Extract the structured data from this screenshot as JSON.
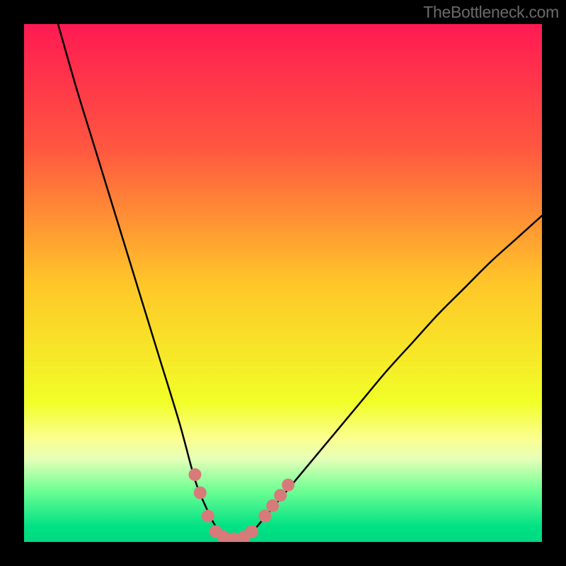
{
  "watermark": "TheBottleneck.com",
  "chart_data": {
    "type": "line",
    "title": "",
    "xlabel": "",
    "ylabel": "",
    "xlim": [
      0,
      100
    ],
    "ylim": [
      0,
      100
    ],
    "gradient_stops": [
      {
        "offset": 0.0,
        "color": "#ff1a52"
      },
      {
        "offset": 0.24,
        "color": "#ff5740"
      },
      {
        "offset": 0.5,
        "color": "#ffc629"
      },
      {
        "offset": 0.73,
        "color": "#f1fe27"
      },
      {
        "offset": 0.8,
        "color": "#fbff90"
      },
      {
        "offset": 0.84,
        "color": "#e5ffb8"
      },
      {
        "offset": 0.9,
        "color": "#6fff94"
      },
      {
        "offset": 0.97,
        "color": "#00e184"
      },
      {
        "offset": 1.0,
        "color": "#00d980"
      }
    ],
    "series": [
      {
        "name": "bottleneck-curve",
        "x": [
          6,
          10,
          14,
          18,
          22,
          26,
          30,
          33,
          35,
          37,
          39,
          41,
          43,
          45,
          50,
          55,
          60,
          65,
          70,
          75,
          80,
          85,
          90,
          95,
          100
        ],
        "y": [
          102,
          88,
          75,
          62,
          49,
          36,
          23,
          12,
          7,
          3,
          1,
          0.5,
          1,
          3,
          9,
          15,
          21,
          27,
          33,
          38.5,
          44,
          49,
          54,
          58.5,
          63
        ]
      }
    ],
    "markers": [
      {
        "x": 33.0,
        "y": 13.0
      },
      {
        "x": 34.0,
        "y": 9.5
      },
      {
        "x": 35.5,
        "y": 5.0
      },
      {
        "x": 37.0,
        "y": 2.0
      },
      {
        "x": 38.5,
        "y": 1.0
      },
      {
        "x": 40.5,
        "y": 0.6
      },
      {
        "x": 42.5,
        "y": 1.0
      },
      {
        "x": 44.0,
        "y": 2.0
      },
      {
        "x": 46.5,
        "y": 5.0
      },
      {
        "x": 48.0,
        "y": 7.0
      },
      {
        "x": 49.5,
        "y": 9.0
      },
      {
        "x": 51.0,
        "y": 11.0
      }
    ],
    "marker_style": {
      "color": "#d87a7a",
      "radius_px": 9
    }
  }
}
